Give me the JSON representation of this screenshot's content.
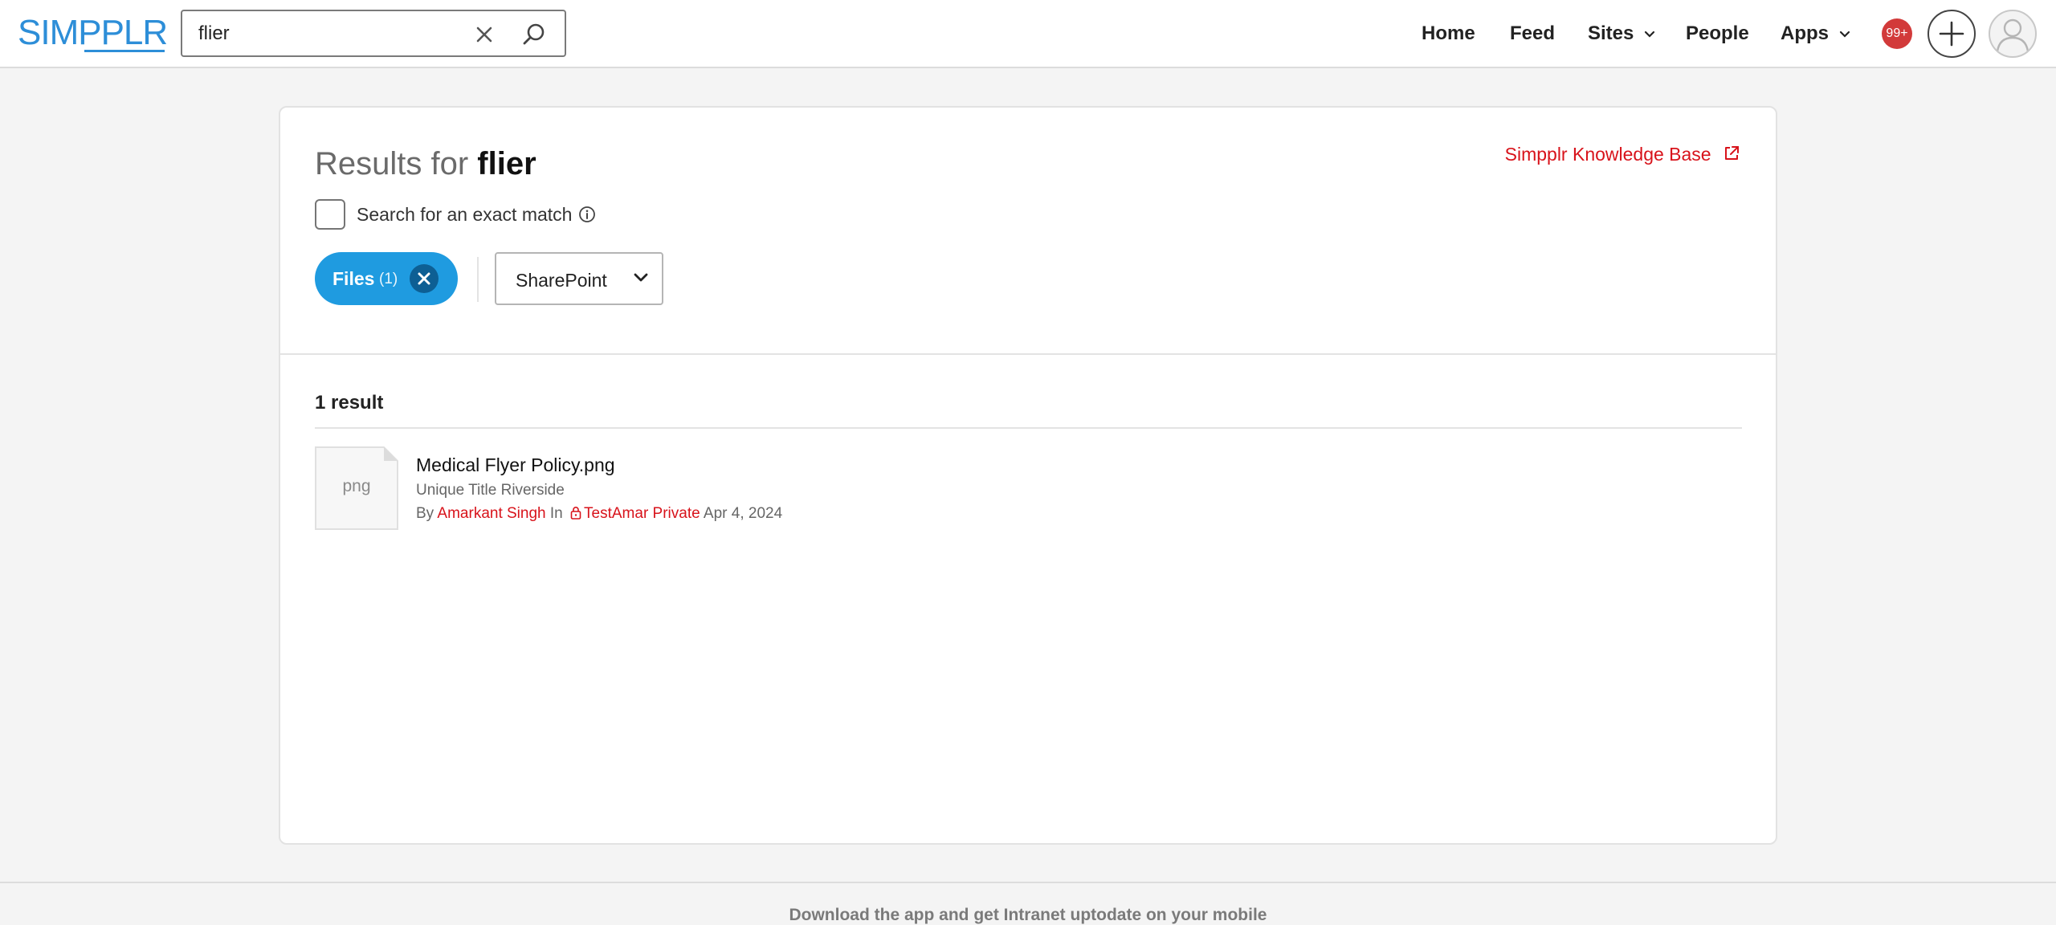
{
  "brand": {
    "logo_text": "SIMPPLR",
    "color": "#2d8ed8"
  },
  "search": {
    "value": "flier",
    "placeholder": ""
  },
  "nav": {
    "home": "Home",
    "feed": "Feed",
    "sites": "Sites",
    "people": "People",
    "apps": "Apps",
    "notification_badge": "99+"
  },
  "results": {
    "title_prefix": "Results for",
    "query": "flier",
    "kb_link": "Simpplr Knowledge Base",
    "exact_match_label": "Search for an exact match",
    "filter_chip_label": "Files",
    "filter_chip_count": "(1)",
    "source_select": "SharePoint",
    "count_label": "1 result",
    "items": [
      {
        "file_ext": "png",
        "title": "Medical Flyer Policy.png",
        "subtitle": "Unique Title Riverside",
        "by_label": "By",
        "author": "Amarkant Singh",
        "in_label": "In",
        "site": "TestAmar Private",
        "date": "Apr 4, 2024"
      }
    ]
  },
  "footer": {
    "text": "Download the app and get Intranet uptodate on your mobile"
  },
  "colors": {
    "accent": "#1f9be0",
    "link": "#d8131b",
    "badge": "#d23a3a"
  }
}
